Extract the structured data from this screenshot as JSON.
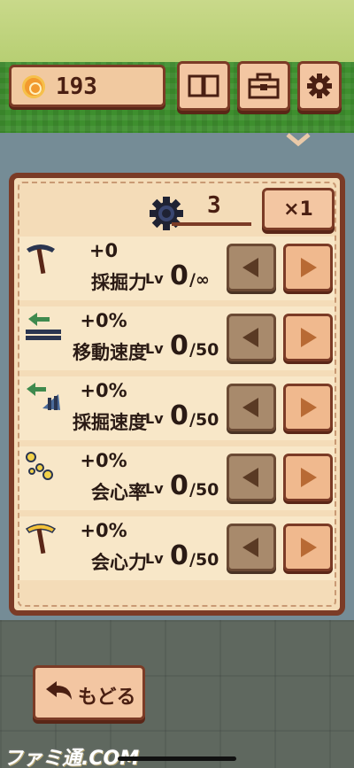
{
  "header": {
    "coins": "193",
    "buttons": [
      {
        "icon": "book-icon"
      },
      {
        "icon": "toolbox-icon"
      },
      {
        "icon": "gear-icon"
      }
    ]
  },
  "panel": {
    "gear_count": "3",
    "multiplier": "×1",
    "lv_label": "Lv",
    "rows": [
      {
        "icon": "pickaxe-icon",
        "value": "+0",
        "name": "採掘力",
        "level": "0",
        "max": "/∞"
      },
      {
        "icon": "move-speed-icon",
        "value": "+0%",
        "name": "移動速度",
        "level": "0",
        "max": "/50"
      },
      {
        "icon": "dig-speed-icon",
        "value": "+0%",
        "name": "採掘速度",
        "level": "0",
        "max": "/50"
      },
      {
        "icon": "crit-rate-icon",
        "value": "+0%",
        "name": "会心率",
        "level": "0",
        "max": "/50"
      },
      {
        "icon": "golden-pickaxe-icon",
        "value": "+0%",
        "name": "会心力",
        "level": "0",
        "max": "/50"
      }
    ]
  },
  "back_button": {
    "label": "もどる"
  },
  "watermark": "ファミ通.COM",
  "colors": {
    "frame": "#7b3b26",
    "panel": "#f4dcb8",
    "button": "#f3c6a2"
  }
}
